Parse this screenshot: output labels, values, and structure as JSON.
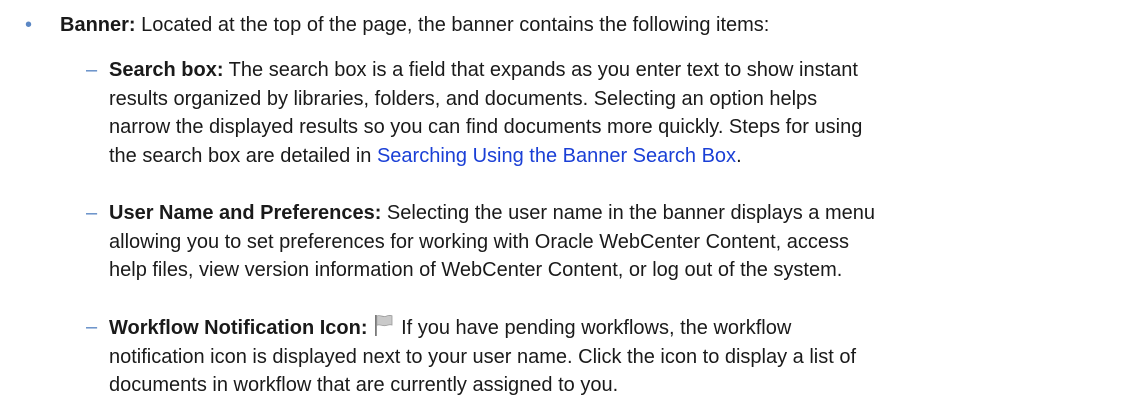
{
  "banner": {
    "bullet": "•",
    "label": "Banner:",
    "text": " Located at the top of the page, the banner contains the following items:"
  },
  "items": [
    {
      "dash": "–",
      "label": "Search box:",
      "lines": [
        " The search box is a field that expands as you enter text to show instant",
        "results organized by libraries, folders, and documents. Selecting an option helps",
        "narrow the displayed results so you can find documents more quickly. Steps for using"
      ],
      "last_prefix": "the search box are detailed in ",
      "link": "Searching Using the Banner Search Box",
      "last_suffix": "."
    },
    {
      "dash": "–",
      "label": "User Name and Preferences:",
      "lines": [
        " Selecting the user name in the banner displays a menu",
        "allowing you to set preferences for working with Oracle WebCenter Content, access",
        "help files, view version information of WebCenter Content, or log out of the system."
      ]
    },
    {
      "dash": "–",
      "label": "Workflow Notification Icon:",
      "icon": "flag-icon",
      "lines": [
        " If you have pending workflows, the workflow",
        "notification icon is displayed next to your user name. Click the icon to display a list of",
        "documents in workflow that are currently assigned to you."
      ]
    }
  ]
}
